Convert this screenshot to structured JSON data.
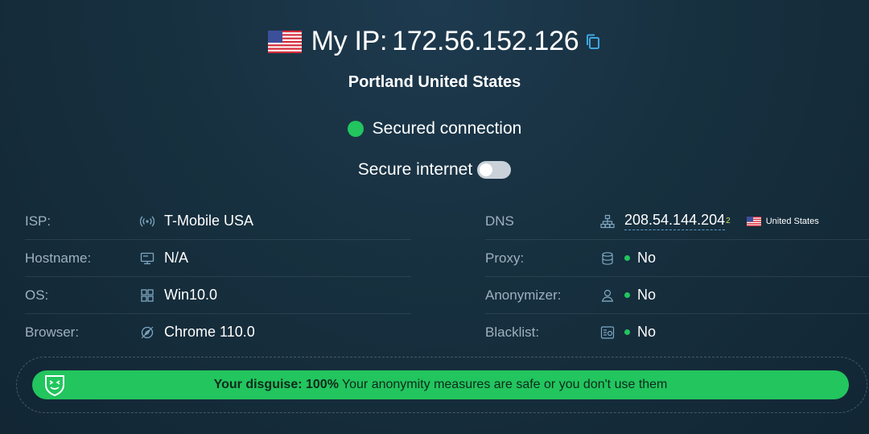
{
  "header": {
    "flag_icon": "us-flag-icon",
    "title_prefix": "My IP:",
    "ip": "172.56.152.126",
    "copy_icon": "copy-icon"
  },
  "location": "Portland United States",
  "connection": {
    "status_text": "Secured connection",
    "status_color": "#22c55e"
  },
  "secure_internet": {
    "label": "Secure internet",
    "enabled": false
  },
  "left_details": [
    {
      "label": "ISP:",
      "icon": "signal-icon",
      "value": "T-Mobile USA"
    },
    {
      "label": "Hostname:",
      "icon": "server-icon",
      "value": "N/A"
    },
    {
      "label": "OS:",
      "icon": "windows-icon",
      "value": "Win10.0"
    },
    {
      "label": "Browser:",
      "icon": "browser-icon",
      "value": "Chrome 110.0"
    }
  ],
  "right_details": [
    {
      "label": "DNS",
      "icon": "network-icon",
      "value": "208.54.144.204",
      "count": "2",
      "country": "United States"
    },
    {
      "label": "Proxy:",
      "icon": "database-icon",
      "value": "No"
    },
    {
      "label": "Anonymizer:",
      "icon": "user-icon",
      "value": "No"
    },
    {
      "label": "Blacklist:",
      "icon": "list-icon",
      "value": "No"
    }
  ],
  "disguise": {
    "icon": "mask-icon",
    "title": "Your disguise: 100%",
    "text": "Your anonymity measures are safe or you don't use them",
    "color": "#22c55e"
  }
}
